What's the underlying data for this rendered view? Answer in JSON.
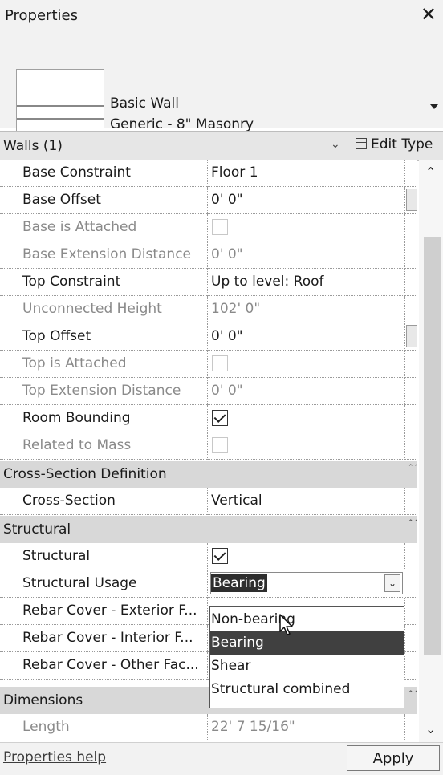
{
  "window": {
    "title": "Properties"
  },
  "type_selector": {
    "family": "Basic Wall",
    "type": "Generic - 8\" Masonry"
  },
  "instance_selector": {
    "label": "Walls (1)",
    "edit_type_label": "Edit Type"
  },
  "rows": [
    {
      "name": "Base Constraint",
      "value": "Floor 1",
      "dim": false
    },
    {
      "name": "Base Offset",
      "value": "0'  0\"",
      "dim": false
    },
    {
      "name": "Base is Attached",
      "checkbox": false,
      "dim": true
    },
    {
      "name": "Base Extension Distance",
      "value": "0'  0\"",
      "dim": true
    },
    {
      "name": "Top Constraint",
      "value": "Up to level: Roof",
      "dim": false
    },
    {
      "name": "Unconnected Height",
      "value": "102'  0\"",
      "dim": true
    },
    {
      "name": "Top Offset",
      "value": "0'  0\"",
      "dim": false
    },
    {
      "name": "Top is Attached",
      "checkbox": false,
      "dim": true
    },
    {
      "name": "Top Extension Distance",
      "value": "0'  0\"",
      "dim": true
    },
    {
      "name": "Room Bounding",
      "checkbox": true,
      "dim": false
    },
    {
      "name": "Related to Mass",
      "checkbox": false,
      "dim": true
    }
  ],
  "sections": {
    "cross_section": {
      "title": "Cross-Section Definition",
      "rows": [
        {
          "name": "Cross-Section",
          "value": "Vertical"
        }
      ]
    },
    "structural": {
      "title": "Structural",
      "rows": [
        {
          "name": "Structural",
          "checkbox": true
        },
        {
          "name": "Structural Usage",
          "value": "Bearing"
        },
        {
          "name": "Rebar Cover - Exterior F..."
        },
        {
          "name": "Rebar Cover - Interior F..."
        },
        {
          "name": "Rebar Cover - Other Fac..."
        }
      ]
    },
    "dimensions": {
      "title": "Dimensions",
      "rows": [
        {
          "name": "Length",
          "value": "22'  7 15/16\"",
          "dim": true
        }
      ]
    }
  },
  "dropdown": {
    "options": [
      "Non-bearing",
      "Bearing",
      "Shear",
      "Structural combined"
    ],
    "selected": "Bearing"
  },
  "footer": {
    "help_link": "Properties help",
    "apply_label": "Apply"
  },
  "glyphs": {
    "close": "✕",
    "chevron_down": "⌄",
    "scroll_up": "⌃",
    "scroll_down": "⌄",
    "collapse": "⌃⌃"
  },
  "colors": {
    "section_bg": "#d8d8d8",
    "selection_bg": "#404040",
    "title_bg": "#f2f2f2"
  }
}
